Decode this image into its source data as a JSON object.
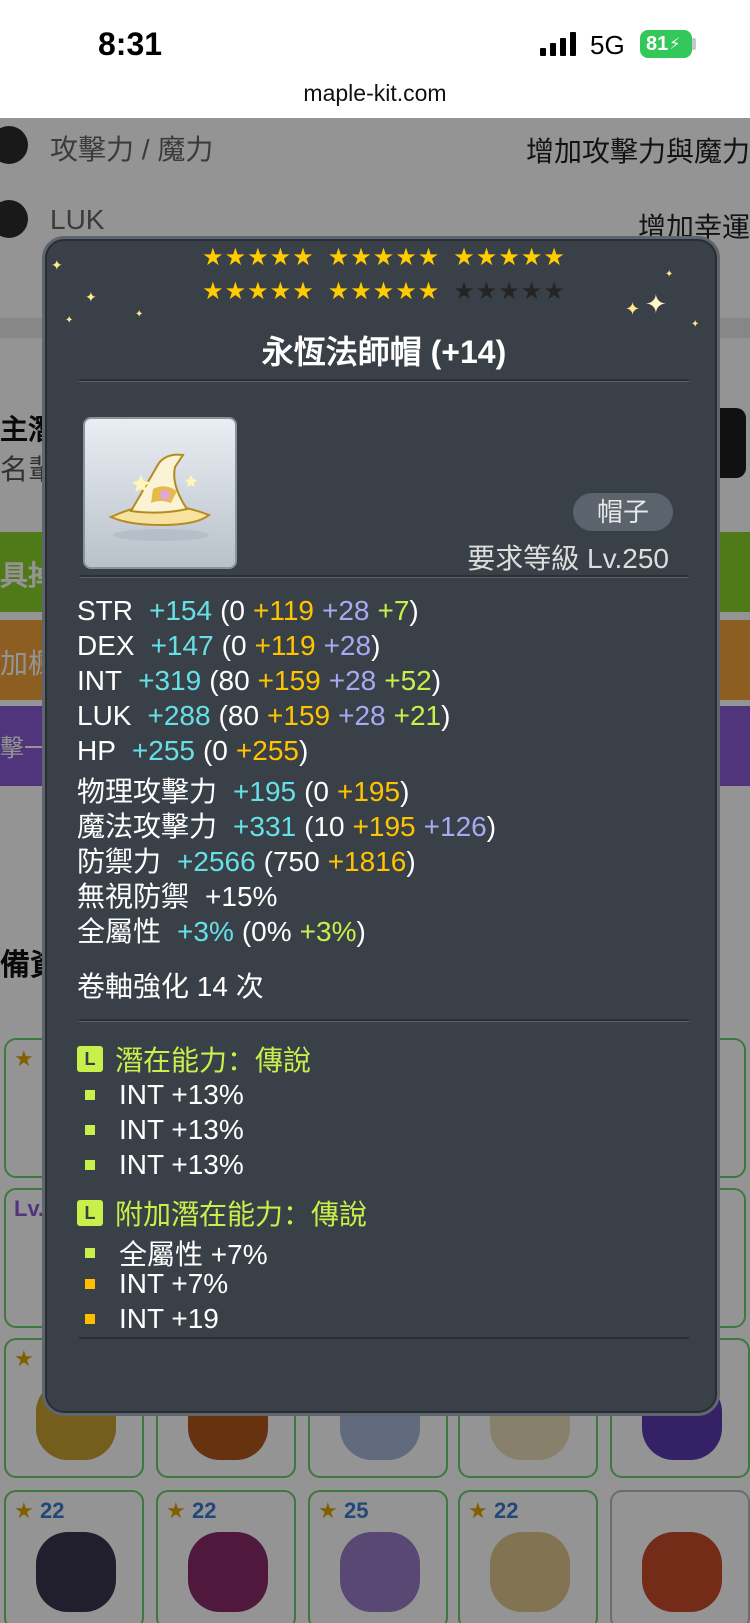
{
  "status_bar": {
    "time": "8:31",
    "network": "5G",
    "battery": "81"
  },
  "browser": {
    "url": "maple-kit.com"
  },
  "background": {
    "row1_label": "攻擊力 / 魔力",
    "row1_desc": "增加攻擊力與魔力",
    "row2_label": "LUK",
    "row2_desc": "增加幸運",
    "partial_1": "主潛",
    "partial_2": "名輩",
    "partial_3": "具掉",
    "partial_4": "加楓",
    "partial_5": "擊一",
    "partial_6": "備資",
    "partial_7": "Lv.",
    "card_numbers": [
      "22",
      "22",
      "25",
      "22"
    ],
    "colors": {
      "green_band": "#8bd12a",
      "orange_band": "#f2a23a",
      "purple_band": "#8a5ad6"
    }
  },
  "tooltip": {
    "stars_row1": {
      "on": 15,
      "off": 0
    },
    "stars_row2": {
      "on": 10,
      "off": 5
    },
    "item_name": "永恆法師帽 (+14)",
    "category": "帽子",
    "required_level": "要求等級 Lv.250",
    "stats": [
      {
        "name": "STR",
        "total": "+154",
        "base": "(0",
        "parts": [
          [
            "+119",
            "gold"
          ],
          [
            "+28",
            "lav"
          ],
          [
            "+7",
            "lime"
          ]
        ],
        "close": ")"
      },
      {
        "name": "DEX",
        "total": "+147",
        "base": "(0",
        "parts": [
          [
            "+119",
            "gold"
          ],
          [
            "+28",
            "lav"
          ]
        ],
        "close": ")"
      },
      {
        "name": "INT",
        "total": "+319",
        "base": "(80",
        "parts": [
          [
            "+159",
            "gold"
          ],
          [
            "+28",
            "lav"
          ],
          [
            "+52",
            "lime"
          ]
        ],
        "close": ")"
      },
      {
        "name": "LUK",
        "total": "+288",
        "base": "(80",
        "parts": [
          [
            "+159",
            "gold"
          ],
          [
            "+28",
            "lav"
          ],
          [
            "+21",
            "lime"
          ]
        ],
        "close": ")"
      },
      {
        "name": "HP",
        "total": "+255",
        "base": "(0",
        "parts": [
          [
            "+255",
            "gold"
          ]
        ],
        "close": ")"
      },
      {
        "name": "物理攻擊力",
        "total": "+195",
        "base": "(0",
        "parts": [
          [
            "+195",
            "gold"
          ]
        ],
        "close": ")"
      },
      {
        "name": "魔法攻擊力",
        "total": "+331",
        "base": "(10",
        "parts": [
          [
            "+195",
            "gold"
          ],
          [
            "+126",
            "lav"
          ]
        ],
        "close": ")"
      },
      {
        "name": "防禦力",
        "total": "+2566",
        "base": "(750",
        "parts": [
          [
            "+1816",
            "gold"
          ]
        ],
        "close": ")"
      },
      {
        "name": "無視防禦",
        "total": "+15%",
        "total_color": "white",
        "base": "",
        "parts": [],
        "close": ""
      },
      {
        "name": "全屬性",
        "total": "+3%",
        "base": "(0%",
        "parts": [
          [
            "+3%",
            "lime"
          ]
        ],
        "close": ")"
      }
    ],
    "scroll_enhance": "卷軸強化 14 次",
    "potential": {
      "badge": "L",
      "title": "潛在能力：傳說",
      "lines": [
        "INT +13%",
        "INT +13%",
        "INT +13%"
      ]
    },
    "additional_potential": {
      "badge": "L",
      "title": "附加潛在能力：傳說",
      "lines": [
        {
          "text": "全屬性 +7%",
          "bullet": "green"
        },
        {
          "text": "INT +7%",
          "bullet": "yellow"
        },
        {
          "text": "INT +19",
          "bullet": "yellow"
        }
      ]
    }
  }
}
